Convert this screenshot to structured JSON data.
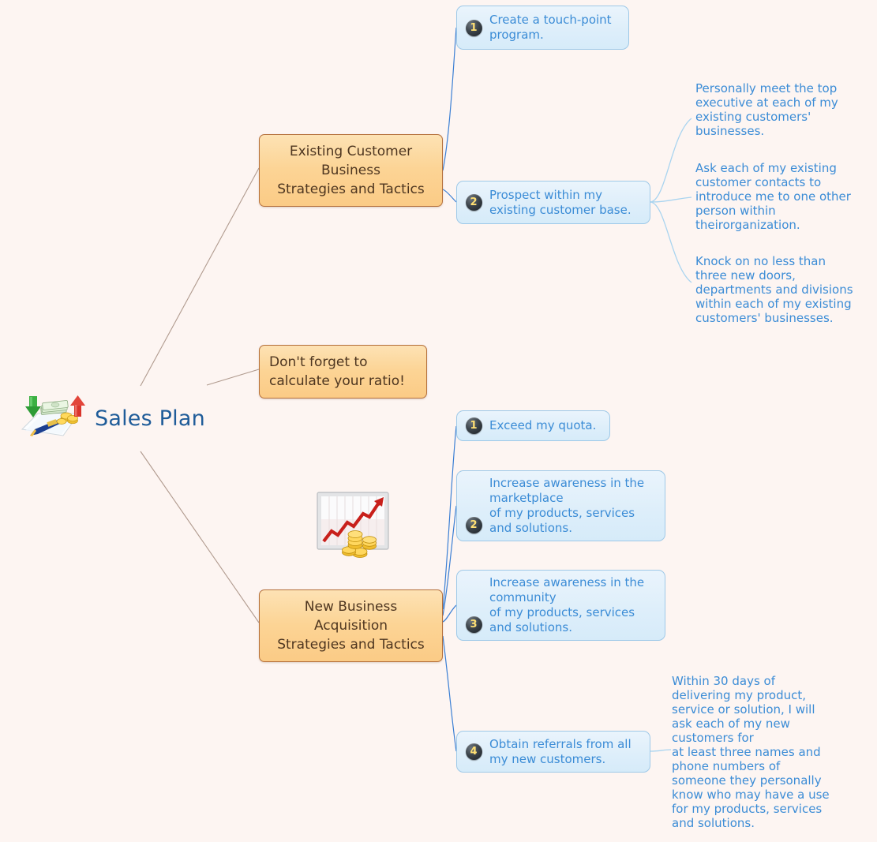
{
  "root": {
    "label": "Sales Plan",
    "icon": "money-pen-arrows-icon"
  },
  "branches": [
    {
      "id": "existing-customer",
      "title": "Existing Customer\nBusiness\nStrategies and Tactics",
      "children": [
        {
          "number": "1",
          "text": "Create a touch-point\nprogram."
        },
        {
          "number": "2",
          "text": "Prospect within my\nexisting customer base."
        }
      ]
    },
    {
      "id": "new-business",
      "title": "New Business\nAcquisition\nStrategies and Tactics",
      "children": [
        {
          "number": "1",
          "text": "Exceed my quota."
        },
        {
          "number": "2",
          "text": "Increase awareness in the\nmarketplace\nof my products, services\nand solutions."
        },
        {
          "number": "3",
          "text": "Increase awareness in the\ncommunity\nof my products, services\nand solutions."
        },
        {
          "number": "4",
          "text": "Obtain referrals from all\nmy new customers."
        }
      ]
    }
  ],
  "note": {
    "text": "Don't forget to\ncalculate your ratio!"
  },
  "leaves": {
    "existing_1": "Personally meet the top\nexecutive at each of my\nexisting customers'\nbusinesses.",
    "existing_2": "Ask each of my existing\ncustomer contacts to\nintroduce me to one other\nperson within\ntheirorganization.",
    "existing_3": "Knock on no less than\nthree new doors,\ndepartments and divisions\nwithin each of my existing\ncustomers' businesses.",
    "referral_detail": "Within 30 days of\ndelivering my product,\nservice or solution, I will\nask each of my new\ncustomers for\nat least three names and\nphone numbers of\nsomeone they personally\nknow who may have a use\nfor my products, services\nand solutions."
  },
  "illustration": {
    "name": "growth-chart-coins-icon"
  },
  "colors": {
    "background": "#fdf5f2",
    "root_text": "#1f5c99",
    "branch_fill": "#fcd495",
    "branch_border": "#b5703c",
    "branch_text": "#4e3620",
    "sub_fill": "#ddeefa",
    "sub_border": "#9ec9e8",
    "sub_text": "#3b8cd6",
    "badge_fill": "#1a1f24",
    "badge_text": "#ffe073",
    "link_root": "#b09a8e",
    "link_branch": "#3b7fd4",
    "link_leaf": "#a9d4f0"
  }
}
